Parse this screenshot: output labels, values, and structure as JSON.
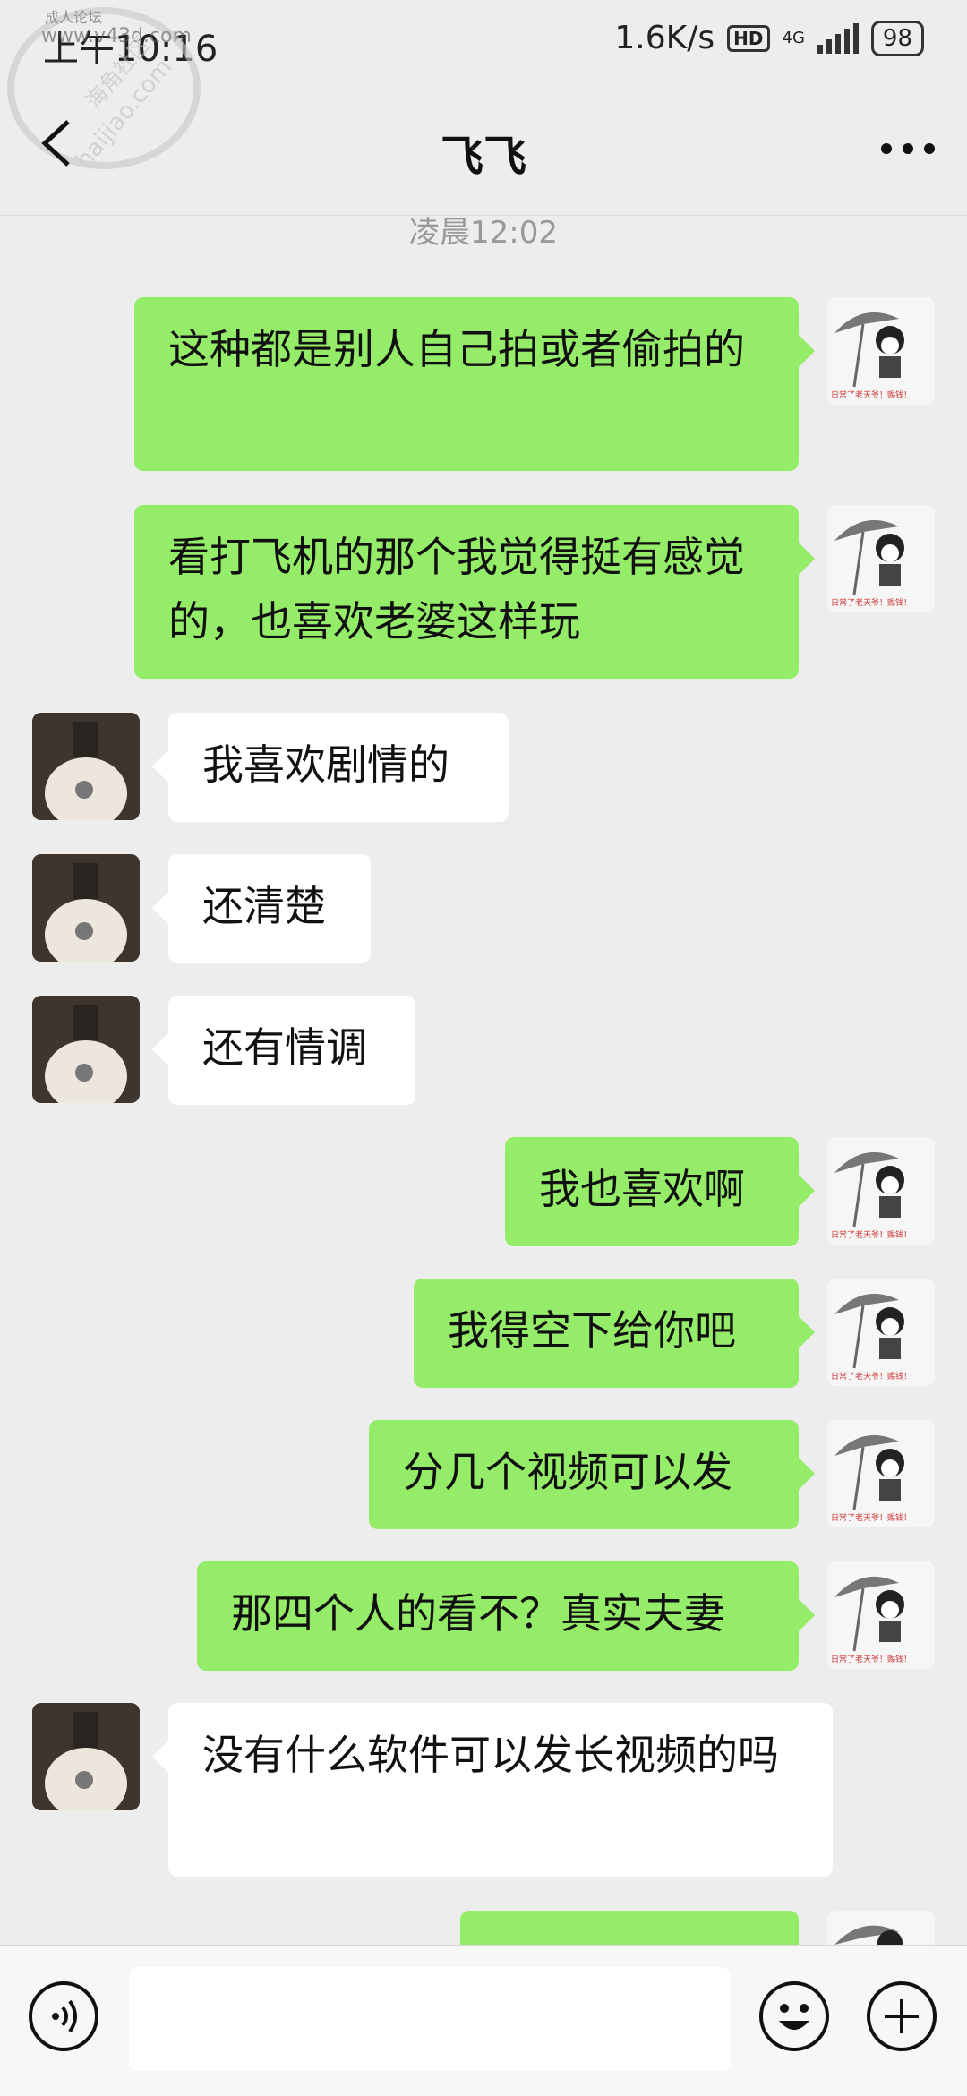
{
  "status_bar": {
    "time": "上午10:16",
    "network_speed": "1.6K/s",
    "hd": "HD",
    "net_type": "4G",
    "battery": "98"
  },
  "watermark": {
    "top_text": "成人论坛",
    "site": "www.v43d.com",
    "seal_text": "海角社区",
    "seal_url": "haijiao.com"
  },
  "header": {
    "title": "飞飞",
    "back_icon": "back-arrow-icon",
    "more_icon": "more-dots-icon"
  },
  "timestamp": "凌晨12:02",
  "messages": [
    {
      "side": "out",
      "text": "这种都是别人自己拍或者偷拍的"
    },
    {
      "side": "out",
      "text": "看打飞机的那个我觉得挺有感觉的，也喜欢老婆这样玩"
    },
    {
      "side": "in",
      "text": "我喜欢剧情的"
    },
    {
      "side": "in",
      "text": "还清楚"
    },
    {
      "side": "in",
      "text": "还有情调"
    },
    {
      "side": "out",
      "text": "我也喜欢啊"
    },
    {
      "side": "out",
      "text": "我得空下给你吧"
    },
    {
      "side": "out",
      "text": "分几个视频可以发"
    },
    {
      "side": "out",
      "text": "那四个人的看不？真实夫妻"
    },
    {
      "side": "in",
      "text": "没有什么软件可以发长视频的吗"
    },
    {
      "side": "out",
      "text": ""
    }
  ],
  "sticker_caption": "日常了老天爷！赐钱！",
  "input_bar": {
    "voice_icon": "voice-icon",
    "emoji_icon": "emoji-icon",
    "plus_icon": "plus-icon",
    "input_value": ""
  },
  "colors": {
    "background": "#ededed",
    "outgoing_bubble": "#95ec69",
    "incoming_bubble": "#ffffff"
  }
}
